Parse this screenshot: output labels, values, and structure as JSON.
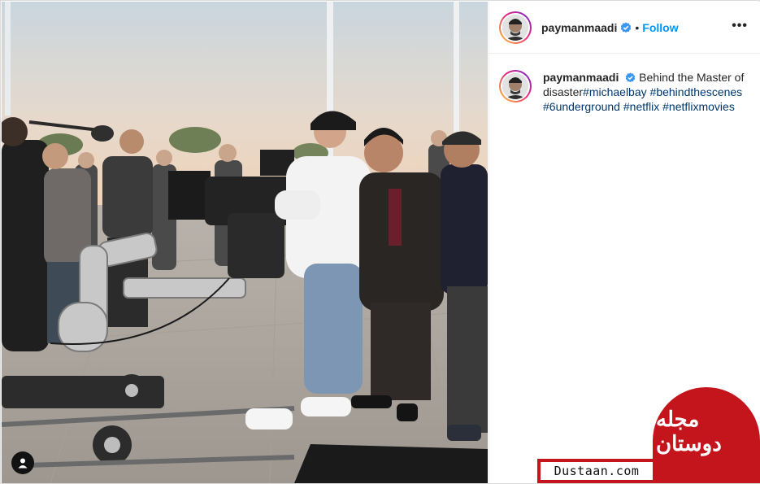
{
  "post": {
    "username": "paymanmaadi",
    "follow_label": "Follow",
    "separator": "•",
    "more_label": "•••",
    "caption_text": "Behind the Master of disaster",
    "hashtags": [
      "#michaelbay",
      "#behindthescenes",
      "#6underground",
      "#netflix",
      "#netflixmovies"
    ]
  },
  "icons": {
    "verified": "verified-badge-icon",
    "tag": "user-tag-icon",
    "more": "more-options-icon"
  },
  "colors": {
    "accent": "#0095f6",
    "verified": "#3897f0",
    "hashtag": "#00376b",
    "watermark": "#c4151c"
  },
  "watermark": {
    "site": "Dustaan.com",
    "logo_text": "مجله دوستان"
  }
}
